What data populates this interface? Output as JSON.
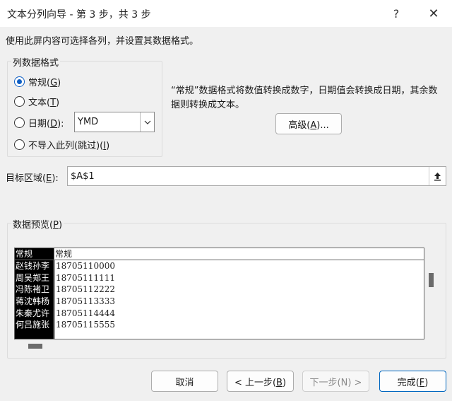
{
  "window": {
    "title": "文本分列向导 - 第 3 步，共 3 步",
    "help_glyph": "?",
    "close_glyph": "✕"
  },
  "instruction": "使用此屏内容可选择各列，并设置其数据格式。",
  "format_group": {
    "title": "列数据格式",
    "options": [
      {
        "label": "常规",
        "key": "G",
        "checked": true
      },
      {
        "label": "文本",
        "key": "T",
        "checked": false
      },
      {
        "label": "日期",
        "key": "D",
        "checked": false
      },
      {
        "label": "不导入此列(跳过)",
        "key": "I",
        "checked": false
      }
    ],
    "date_format": "YMD"
  },
  "description": "“常规”数据格式将数值转换成数字，日期值会转换成日期，其余数据则转换成文本。",
  "advanced_button": {
    "label": "高级",
    "key": "A"
  },
  "target": {
    "label": "目标区域",
    "key": "E",
    "value": "$A$1"
  },
  "preview": {
    "title": "数据预览",
    "key": "P",
    "headers": [
      "常规",
      "常规"
    ],
    "rows": [
      [
        "赵钱孙李",
        "18705110000"
      ],
      [
        "周吴郑王",
        "18705111111"
      ],
      [
        "冯陈褚卫",
        "18705112222"
      ],
      [
        "蒋沈韩杨",
        "18705113333"
      ],
      [
        "朱秦尤许",
        "18705114444"
      ],
      [
        "何吕施张",
        "18705115555"
      ]
    ]
  },
  "buttons": {
    "cancel": "取消",
    "back": "< 上一步",
    "back_key": "B",
    "next": "下一步(N) >",
    "finish": "完成",
    "finish_key": "F"
  }
}
